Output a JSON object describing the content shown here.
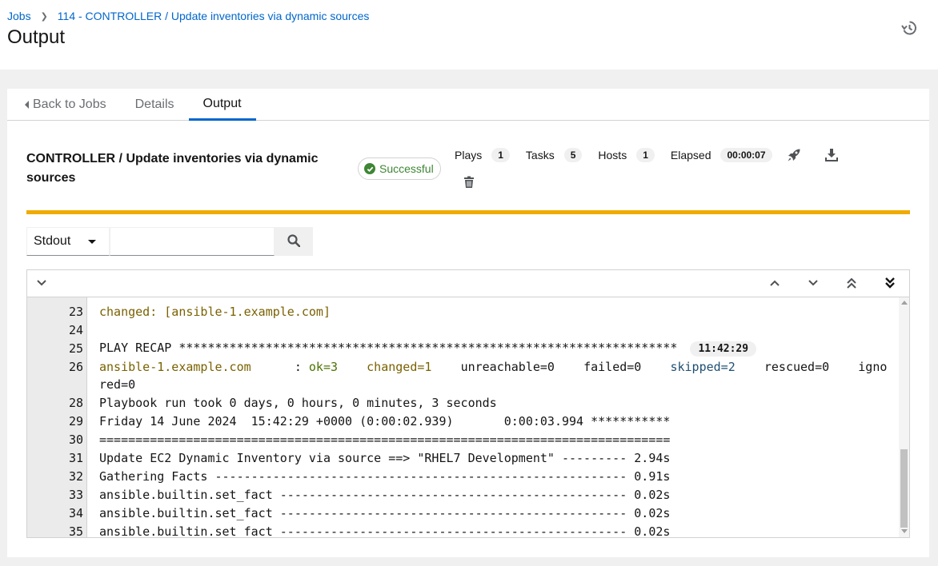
{
  "breadcrumb": {
    "jobs": "Jobs",
    "current": "114 - CONTROLLER / Update inventories via dynamic sources"
  },
  "page": {
    "title": "Output"
  },
  "tabs": [
    {
      "label": "Back to Jobs"
    },
    {
      "label": "Details"
    },
    {
      "label": "Output"
    }
  ],
  "job": {
    "title": "CONTROLLER / Update inventories via dynamic sources",
    "status": "Successful",
    "stats": {
      "plays_label": "Plays",
      "plays": "1",
      "tasks_label": "Tasks",
      "tasks": "5",
      "hosts_label": "Hosts",
      "hosts": "1",
      "elapsed_label": "Elapsed",
      "elapsed": "00:00:07"
    }
  },
  "search": {
    "filter": "Stdout",
    "value": ""
  },
  "output": {
    "line23": {
      "num": "23",
      "text": "changed: [ansible-1.example.com]"
    },
    "line24": {
      "num": "24"
    },
    "line25": {
      "num": "25",
      "text": "PLAY RECAP *********************************************************************",
      "time": "11:42:29"
    },
    "line26": {
      "num": "26",
      "host": "ansible-1.example.com",
      "sep": "      : ",
      "ok": "ok=3",
      "changed": "changed=1",
      "unreachable": "unreachable=0",
      "failed": "failed=0",
      "skipped": "skipped=2",
      "rescued": "rescued=0",
      "ignored_a": "igno",
      "ignored_b": "red=0"
    },
    "line28": {
      "num": "28",
      "text": "Playbook run took 0 days, 0 hours, 0 minutes, 3 seconds"
    },
    "line29": {
      "num": "29",
      "text": "Friday 14 June 2024  15:42:29 +0000 (0:00:02.939)       0:00:03.994 ***********"
    },
    "line30": {
      "num": "30",
      "text": "==============================================================================="
    },
    "line31": {
      "num": "31",
      "text": "Update EC2 Dynamic Inventory via source ==> \"RHEL7 Development\" --------- 2.94s"
    },
    "line32": {
      "num": "32",
      "text": "Gathering Facts --------------------------------------------------------- 0.91s"
    },
    "line33": {
      "num": "33",
      "text": "ansible.builtin.set_fact ------------------------------------------------ 0.02s"
    },
    "line34": {
      "num": "34",
      "text": "ansible.builtin.set_fact ------------------------------------------------ 0.02s"
    },
    "line35": {
      "num": "35",
      "text": "ansible.builtin.set_fact ------------------------------------------------ 0.02s"
    }
  },
  "colors": {
    "accent": "#0066cc",
    "success": "#3e8635",
    "divider": "#f0ab00"
  },
  "icons": [
    "history-icon",
    "check-circle-icon",
    "rocket-icon",
    "download-icon",
    "trash-icon",
    "search-icon",
    "chevron-down-icon",
    "angle-up-icon",
    "angle-down-icon",
    "angle-double-up-icon",
    "angle-double-down-icon"
  ]
}
